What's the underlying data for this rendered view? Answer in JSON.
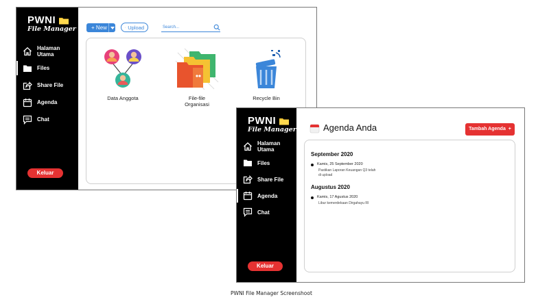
{
  "window1": {
    "logo_title": "PWNI",
    "logo_subtitle": "File Manager",
    "nav": [
      {
        "label": "Halaman Utama",
        "icon": "home-icon"
      },
      {
        "label": "Files",
        "icon": "folder-icon"
      },
      {
        "label": "Share File",
        "icon": "share-icon"
      },
      {
        "label": "Agenda",
        "icon": "calendar-icon"
      },
      {
        "label": "Chat",
        "icon": "chat-icon"
      }
    ],
    "active_nav": "Files",
    "logout_label": "Keluar",
    "toolbar": {
      "new_label": "+ New",
      "upload_label": "Upload",
      "search_placeholder": "Search..."
    },
    "tiles": [
      {
        "label": "Data Anggota",
        "icon": "members-icon"
      },
      {
        "label": "File-file\nOrganisasi",
        "icon": "folders-icon"
      },
      {
        "label": "Recycle Bin",
        "icon": "recycle-bin-icon"
      }
    ]
  },
  "window2": {
    "logo_title": "PWNI",
    "logo_subtitle": "File Manager",
    "nav": [
      {
        "label": "Halaman Utama",
        "icon": "home-icon"
      },
      {
        "label": "Files",
        "icon": "folder-icon"
      },
      {
        "label": "Share File",
        "icon": "share-icon"
      },
      {
        "label": "Agenda",
        "icon": "calendar-icon"
      },
      {
        "label": "Chat",
        "icon": "chat-icon"
      }
    ],
    "active_nav": "Agenda",
    "logout_label": "Keluar",
    "page_title": "Agenda Anda",
    "add_button_label": "Tambah Agenda  +",
    "groups": [
      {
        "month": "September 2020",
        "items": [
          {
            "date": "Kamis, 25 September 2020",
            "text": "Pastikan Laporan Keuangan Q3 telah\ndi upload"
          }
        ]
      },
      {
        "month": "Augustus 2020",
        "items": [
          {
            "date": "Kamis, 17 Agustus 2020",
            "text": "Libur kemerdekaan Dirgahayu RI"
          }
        ]
      }
    ]
  },
  "caption": "PWNI File Manager Screenshoot",
  "colors": {
    "accent": "#3b86d9",
    "danger": "#e53232",
    "sidebar": "#000000"
  }
}
